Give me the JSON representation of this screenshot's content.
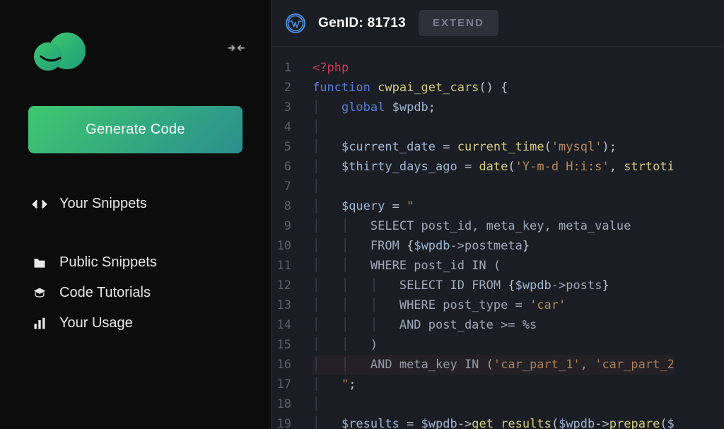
{
  "sidebar": {
    "generate_label": "Generate Code",
    "nav": [
      {
        "label": "Your Snippets",
        "icon": "code"
      },
      {
        "label": "Public Snippets",
        "icon": "folder"
      },
      {
        "label": "Code Tutorials",
        "icon": "education"
      },
      {
        "label": "Your Usage",
        "icon": "chart"
      }
    ]
  },
  "header": {
    "title": "GenID: 81713",
    "extend_label": "EXTEND"
  },
  "code": {
    "lines": [
      {
        "n": 1,
        "tokens": [
          {
            "t": "<?php",
            "c": "tok-open"
          }
        ]
      },
      {
        "n": 2,
        "tokens": [
          {
            "t": "function ",
            "c": "tok-kw"
          },
          {
            "t": "cwpai_get_cars",
            "c": "tok-fn"
          },
          {
            "t": "() {",
            "c": "tok-punc"
          }
        ]
      },
      {
        "n": 3,
        "tokens": [
          {
            "t": "│   ",
            "c": "guide"
          },
          {
            "t": "global ",
            "c": "tok-kw"
          },
          {
            "t": "$wpdb",
            "c": "tok-var"
          },
          {
            "t": ";",
            "c": "tok-punc"
          }
        ]
      },
      {
        "n": 4,
        "tokens": [
          {
            "t": "│",
            "c": "guide"
          }
        ]
      },
      {
        "n": 5,
        "tokens": [
          {
            "t": "│   ",
            "c": "guide"
          },
          {
            "t": "$current_date",
            "c": "tok-var"
          },
          {
            "t": " = ",
            "c": "tok-op"
          },
          {
            "t": "current_time",
            "c": "tok-builtin"
          },
          {
            "t": "(",
            "c": "tok-punc"
          },
          {
            "t": "'mysql'",
            "c": "tok-str"
          },
          {
            "t": ");",
            "c": "tok-punc"
          }
        ]
      },
      {
        "n": 6,
        "tokens": [
          {
            "t": "│   ",
            "c": "guide"
          },
          {
            "t": "$thirty_days_ago",
            "c": "tok-var"
          },
          {
            "t": " = ",
            "c": "tok-op"
          },
          {
            "t": "date",
            "c": "tok-builtin"
          },
          {
            "t": "(",
            "c": "tok-punc"
          },
          {
            "t": "'Y-m-d H:i:s'",
            "c": "tok-str"
          },
          {
            "t": ", ",
            "c": "tok-punc"
          },
          {
            "t": "strtoti",
            "c": "tok-builtin"
          }
        ]
      },
      {
        "n": 7,
        "tokens": [
          {
            "t": "│",
            "c": "guide"
          }
        ]
      },
      {
        "n": 8,
        "tokens": [
          {
            "t": "│   ",
            "c": "guide"
          },
          {
            "t": "$query",
            "c": "tok-var"
          },
          {
            "t": " = ",
            "c": "tok-op"
          },
          {
            "t": "\"",
            "c": "tok-str"
          }
        ]
      },
      {
        "n": 9,
        "tokens": [
          {
            "t": "│   │   ",
            "c": "guide"
          },
          {
            "t": "SELECT post_id, meta_key, meta_value",
            "c": "tok-sql"
          }
        ]
      },
      {
        "n": 10,
        "tokens": [
          {
            "t": "│   │   ",
            "c": "guide"
          },
          {
            "t": "FROM ",
            "c": "tok-sql"
          },
          {
            "t": "{",
            "c": "tok-punc"
          },
          {
            "t": "$wpdb",
            "c": "tok-var"
          },
          {
            "t": "->postmeta",
            "c": "tok-sql"
          },
          {
            "t": "}",
            "c": "tok-punc"
          }
        ]
      },
      {
        "n": 11,
        "tokens": [
          {
            "t": "│   │   ",
            "c": "guide"
          },
          {
            "t": "WHERE post_id IN (",
            "c": "tok-sql"
          }
        ]
      },
      {
        "n": 12,
        "tokens": [
          {
            "t": "│   │   │   ",
            "c": "guide"
          },
          {
            "t": "SELECT ID FROM ",
            "c": "tok-sql"
          },
          {
            "t": "{",
            "c": "tok-punc"
          },
          {
            "t": "$wpdb",
            "c": "tok-var"
          },
          {
            "t": "->posts",
            "c": "tok-sql"
          },
          {
            "t": "}",
            "c": "tok-punc"
          }
        ]
      },
      {
        "n": 13,
        "tokens": [
          {
            "t": "│   │   │   ",
            "c": "guide"
          },
          {
            "t": "WHERE post_type = ",
            "c": "tok-sql"
          },
          {
            "t": "'car'",
            "c": "tok-str"
          }
        ]
      },
      {
        "n": 14,
        "tokens": [
          {
            "t": "│   │   │   ",
            "c": "guide"
          },
          {
            "t": "AND post_date >= %s",
            "c": "tok-sql"
          }
        ]
      },
      {
        "n": 15,
        "tokens": [
          {
            "t": "│   │   ",
            "c": "guide"
          },
          {
            "t": ")",
            "c": "tok-sql"
          }
        ]
      },
      {
        "n": 16,
        "highlight": true,
        "tokens": [
          {
            "t": "│   │   ",
            "c": "guide"
          },
          {
            "t": "AND meta_key IN (",
            "c": "tok-sql"
          },
          {
            "t": "'car_part_1'",
            "c": "tok-str"
          },
          {
            "t": ", ",
            "c": "tok-sql"
          },
          {
            "t": "'car_part_2",
            "c": "tok-str"
          }
        ]
      },
      {
        "n": 17,
        "tokens": [
          {
            "t": "│   ",
            "c": "guide"
          },
          {
            "t": "\"",
            "c": "tok-str"
          },
          {
            "t": ";",
            "c": "tok-punc"
          }
        ]
      },
      {
        "n": 18,
        "tokens": [
          {
            "t": "│",
            "c": "guide"
          }
        ]
      },
      {
        "n": 19,
        "tokens": [
          {
            "t": "│   ",
            "c": "guide"
          },
          {
            "t": "$results",
            "c": "tok-var"
          },
          {
            "t": " = ",
            "c": "tok-op"
          },
          {
            "t": "$wpdb",
            "c": "tok-var"
          },
          {
            "t": "->",
            "c": "tok-op"
          },
          {
            "t": "get_results",
            "c": "tok-builtin"
          },
          {
            "t": "(",
            "c": "tok-punc"
          },
          {
            "t": "$wpdb",
            "c": "tok-var"
          },
          {
            "t": "->",
            "c": "tok-op"
          },
          {
            "t": "prepare",
            "c": "tok-builtin"
          },
          {
            "t": "(",
            "c": "tok-punc"
          },
          {
            "t": "$",
            "c": "tok-var"
          }
        ]
      }
    ]
  }
}
